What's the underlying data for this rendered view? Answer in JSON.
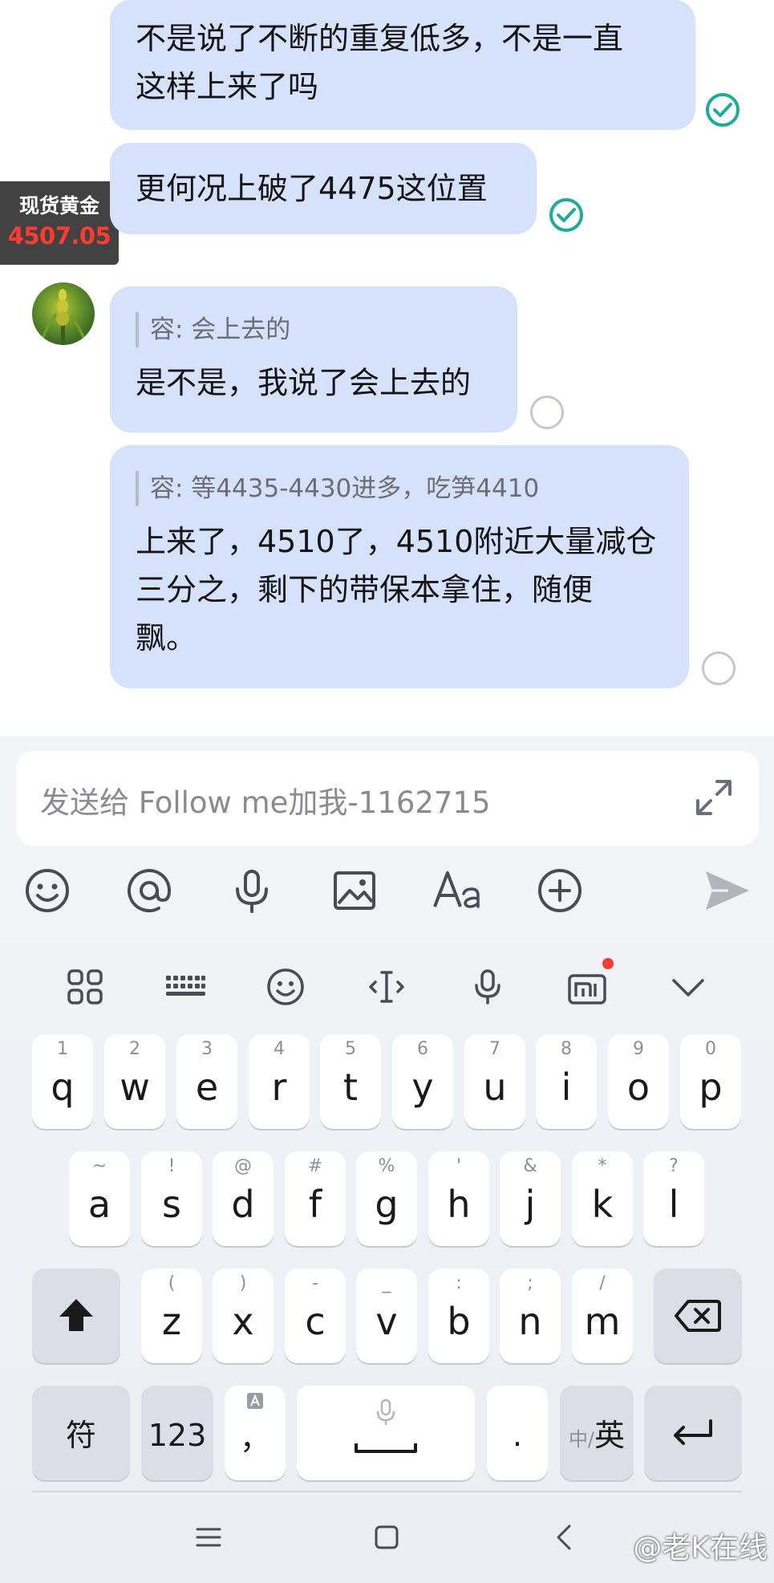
{
  "chat": {
    "price_tag": {
      "label": "现货黄金",
      "value": "4507.05"
    },
    "messages": [
      {
        "text_line1": "不是说了不断的重复低多，不是一直",
        "text_line2": "这样上来了吗",
        "status": "read"
      },
      {
        "text": "更何况上破了4475这位置",
        "status": "read"
      },
      {
        "quote": "容: 会上去的",
        "text": "是不是，我说了会上去的",
        "status": "unread"
      },
      {
        "quote": "容: 等4435-4430进多，吃笋4410",
        "text_line1": "上来了，4510了，4510附近大量减仓",
        "text_line2": "三分之，剩下的带保本拿住，随便",
        "text_line3": "飘。",
        "status": "unread"
      }
    ]
  },
  "composer": {
    "placeholder": "发送给 Follow me加我-1162715",
    "tools": [
      "emoji-icon",
      "mention-icon",
      "voice-icon",
      "image-icon",
      "font-icon",
      "plus-icon",
      "send-icon"
    ]
  },
  "keyboard": {
    "row1": [
      {
        "hint": "1",
        "key": "q"
      },
      {
        "hint": "2",
        "key": "w"
      },
      {
        "hint": "3",
        "key": "e"
      },
      {
        "hint": "4",
        "key": "r"
      },
      {
        "hint": "5",
        "key": "t"
      },
      {
        "hint": "6",
        "key": "y"
      },
      {
        "hint": "7",
        "key": "u"
      },
      {
        "hint": "8",
        "key": "i"
      },
      {
        "hint": "9",
        "key": "o"
      },
      {
        "hint": "0",
        "key": "p"
      }
    ],
    "row2": [
      {
        "hint": "~",
        "key": "a"
      },
      {
        "hint": "!",
        "key": "s"
      },
      {
        "hint": "@",
        "key": "d"
      },
      {
        "hint": "#",
        "key": "f"
      },
      {
        "hint": "%",
        "key": "g"
      },
      {
        "hint": "'",
        "key": "h"
      },
      {
        "hint": "&",
        "key": "j"
      },
      {
        "hint": "*",
        "key": "k"
      },
      {
        "hint": "?",
        "key": "l"
      }
    ],
    "row3": [
      {
        "hint": "(",
        "key": "z"
      },
      {
        "hint": ")",
        "key": "x"
      },
      {
        "hint": "-",
        "key": "c"
      },
      {
        "hint": "_",
        "key": "v"
      },
      {
        "hint": ":",
        "key": "b"
      },
      {
        "hint": ";",
        "key": "n"
      },
      {
        "hint": "/",
        "key": "m"
      }
    ],
    "symbol_key": "符",
    "number_key": "123",
    "comma_key": "，",
    "period_key": ".",
    "lang_key_secondary": "中/",
    "lang_key_primary": "英"
  },
  "watermark": "@老K在线"
}
